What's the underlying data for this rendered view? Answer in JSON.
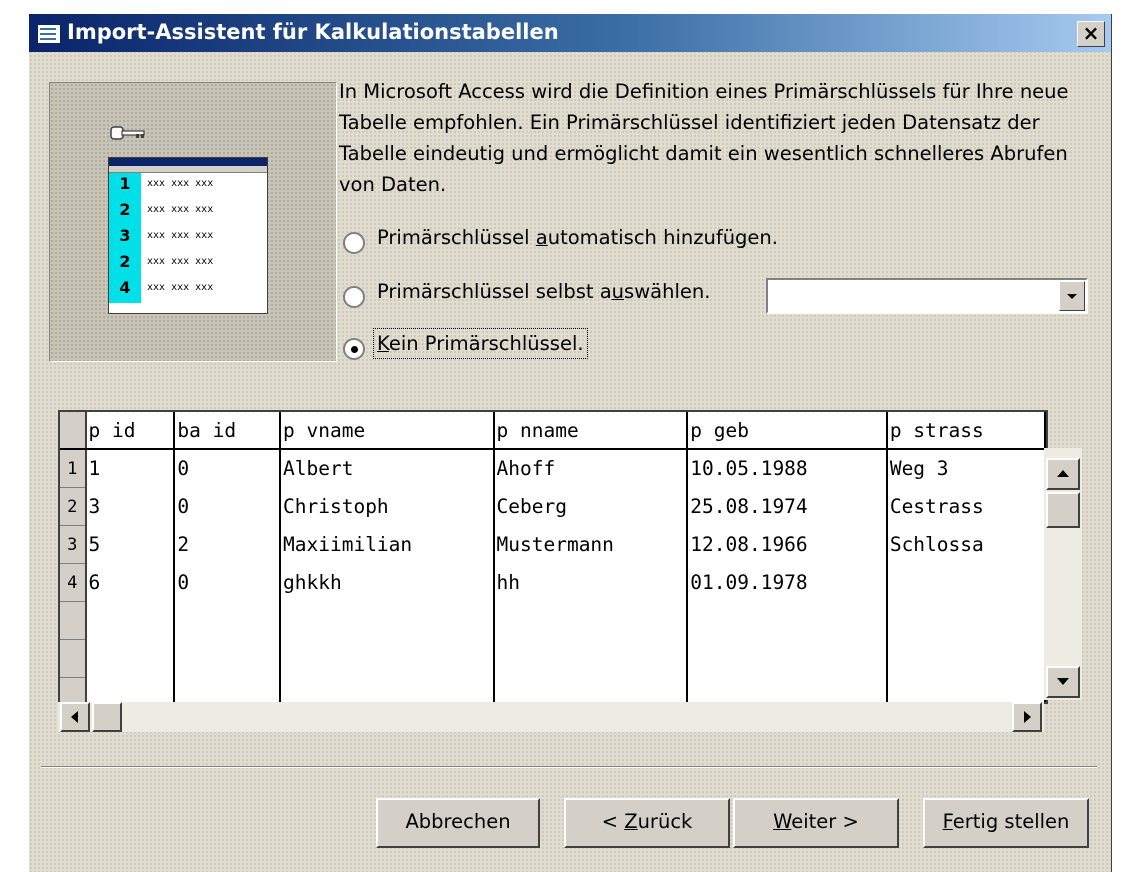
{
  "window": {
    "title": "Import-Assistent für Kalkulationstabellen",
    "close_label": "×"
  },
  "graphic": {
    "rows": [
      "1",
      "2",
      "3",
      "2",
      "4"
    ],
    "placeholder": "xxx xxx xxx"
  },
  "description": "In Microsoft Access wird die Definition eines Primärschlüssels für Ihre neue Tabelle empfohlen.  Ein Primärschlüssel identifiziert jeden Datensatz der Tabelle eindeutig und ermöglicht damit ein wesentlich schnelleres Abrufen von Daten.",
  "options": [
    {
      "label_pre": "Primärschlüssel ",
      "hotkey": "a",
      "label_post": "utomatisch hinzufügen.",
      "checked": false
    },
    {
      "label_pre": "Primärschlüssel selbst a",
      "hotkey": "u",
      "label_post": "swählen.",
      "checked": false
    },
    {
      "label_pre": "",
      "hotkey": "K",
      "label_post": "ein Primärschlüssel.",
      "checked": true
    }
  ],
  "key_field_combo": {
    "value": ""
  },
  "table": {
    "columns": [
      "p id",
      "ba id",
      "p vname",
      "p nname",
      "p geb",
      "p strass"
    ],
    "rows": [
      {
        "num": "1",
        "cells": [
          "1",
          "0",
          "Albert",
          "Ahoff",
          "10.05.1988",
          "Weg 3"
        ]
      },
      {
        "num": "2",
        "cells": [
          "3",
          "0",
          "Christoph",
          "Ceberg",
          "25.08.1974",
          "Cestrass"
        ]
      },
      {
        "num": "3",
        "cells": [
          "5",
          "2",
          "Maxiimilian",
          "Mustermann",
          "12.08.1966",
          "Schlossa"
        ]
      },
      {
        "num": "4",
        "cells": [
          "6",
          "0",
          "ghkkh",
          "hh",
          "01.09.1978",
          ""
        ]
      }
    ]
  },
  "buttons": {
    "cancel": {
      "label": "Abbrechen"
    },
    "back": {
      "pre": "< ",
      "hotkey": "Z",
      "post": "urück"
    },
    "next": {
      "pre": "",
      "hotkey": "W",
      "post": "eiter >"
    },
    "finish": {
      "pre": "",
      "hotkey": "F",
      "post": "ertig stellen"
    }
  }
}
